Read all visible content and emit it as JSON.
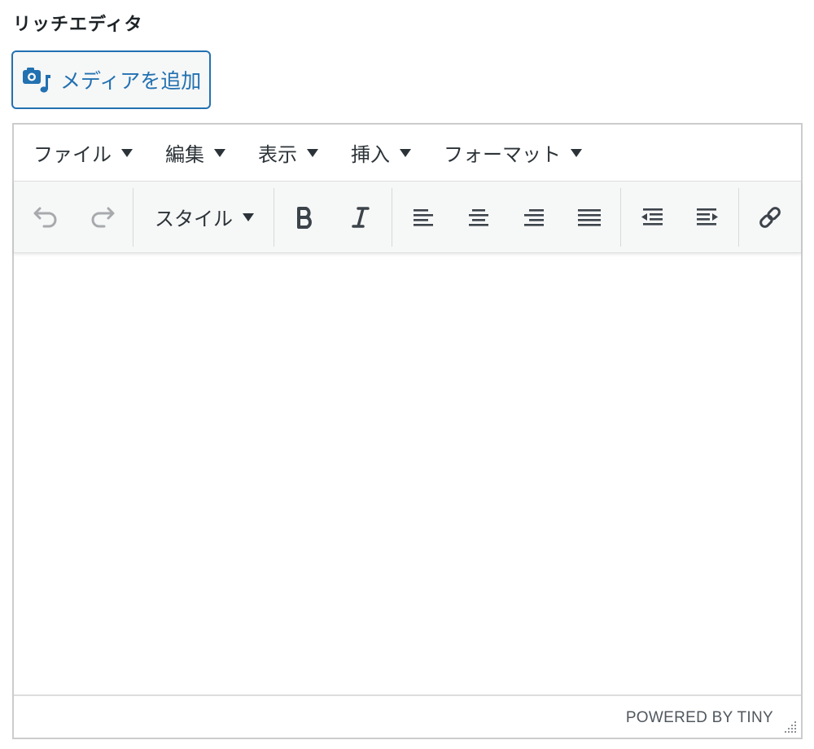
{
  "field": {
    "label": "リッチエディタ"
  },
  "media_button": {
    "label": "メディアを追加",
    "icon": "media-camera-music-icon",
    "color": "#2271b1"
  },
  "menubar": {
    "items": [
      {
        "label": "ファイル"
      },
      {
        "label": "編集"
      },
      {
        "label": "表示"
      },
      {
        "label": "挿入"
      },
      {
        "label": "フォーマット"
      }
    ]
  },
  "toolbar": {
    "styles_label": "スタイル",
    "buttons": [
      "undo-icon",
      "redo-icon",
      "bold-icon",
      "italic-icon",
      "align-left-icon",
      "align-center-icon",
      "align-right-icon",
      "align-justify-icon",
      "outdent-icon",
      "indent-icon",
      "link-icon"
    ]
  },
  "statusbar": {
    "powered_by": "POWERED BY TINY"
  }
}
